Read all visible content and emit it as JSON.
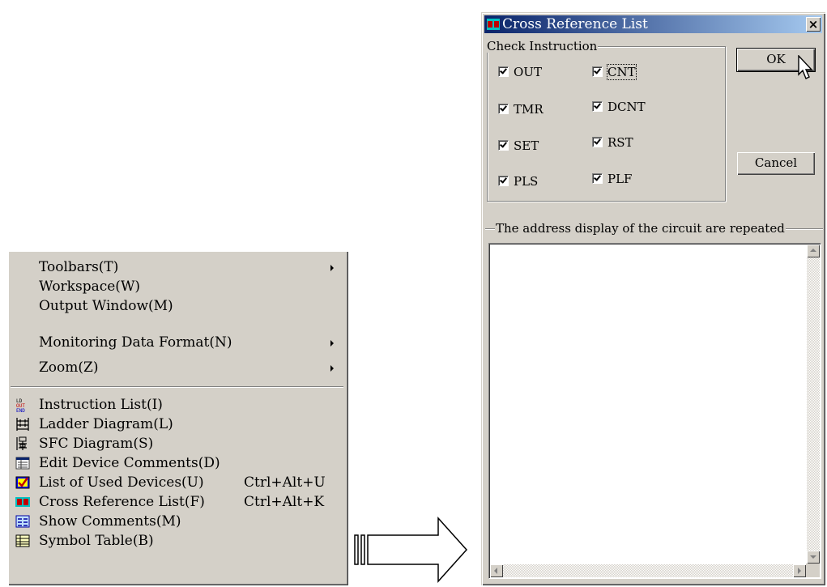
{
  "menu": {
    "items": [
      {
        "label": "Toolbars(T)",
        "submenu": true
      },
      {
        "label": "Workspace(W)"
      },
      {
        "label": "Output Window(M)"
      },
      {
        "label": "Monitoring Data Format(N)",
        "submenu": true
      },
      {
        "label": "Zoom(Z)",
        "submenu": true
      },
      {
        "label": "Instruction List(I)",
        "icon": "instruction-list-icon"
      },
      {
        "label": "Ladder Diagram(L)",
        "icon": "ladder-diagram-icon"
      },
      {
        "label": "SFC Diagram(S)",
        "icon": "sfc-diagram-icon"
      },
      {
        "label": "Edit Device Comments(D)",
        "icon": "device-comments-icon"
      },
      {
        "label": "List of Used Devices(U)",
        "shortcut": "Ctrl+Alt+U",
        "icon": "used-devices-icon"
      },
      {
        "label": "Cross Reference List(F)",
        "shortcut": "Ctrl+Alt+K",
        "icon": "cross-reference-icon"
      },
      {
        "label": "Show Comments(M)",
        "icon": "show-comments-icon"
      },
      {
        "label": "Symbol Table(B)",
        "icon": "symbol-table-icon"
      }
    ]
  },
  "dialog": {
    "title": "Cross Reference List",
    "close_glyph": "×",
    "check_group_label": "Check Instruction",
    "checkboxes": [
      {
        "label": "OUT",
        "checked": true
      },
      {
        "label": "CNT",
        "checked": true
      },
      {
        "label": "TMR",
        "checked": true
      },
      {
        "label": "DCNT",
        "checked": true
      },
      {
        "label": "SET",
        "checked": true
      },
      {
        "label": "RST",
        "checked": true
      },
      {
        "label": "PLS",
        "checked": true
      },
      {
        "label": "PLF",
        "checked": true
      }
    ],
    "ok_label": "OK",
    "cancel_label": "Cancel",
    "list_group_label": "The address display of the circuit are repeated"
  }
}
